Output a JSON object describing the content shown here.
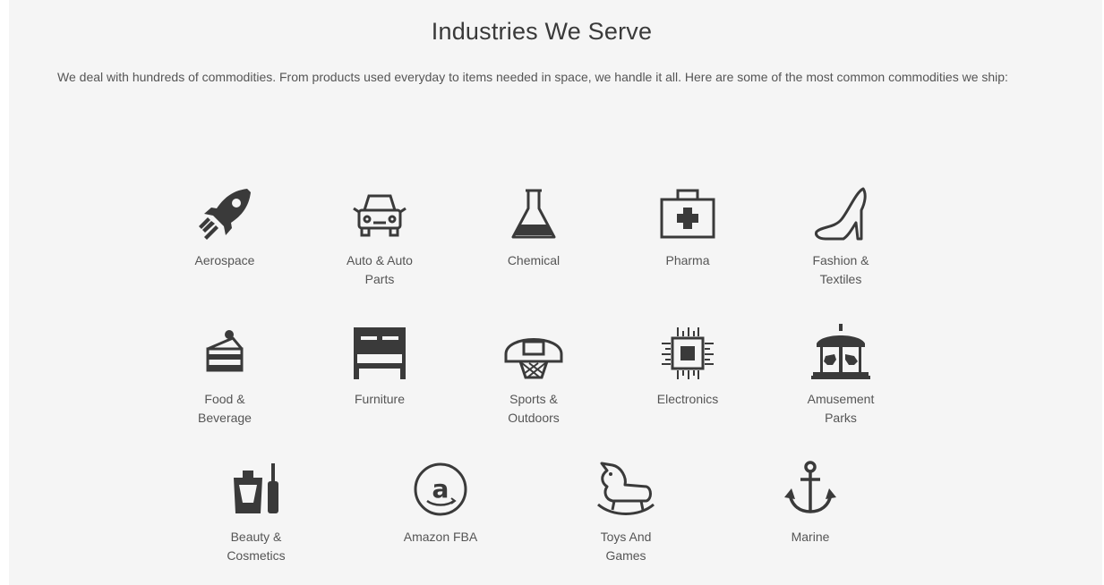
{
  "section": {
    "title": "Industries We Serve",
    "intro": "We deal with hundreds of commodities. From products used everyday to items needed in space, we handle it all. Here are some of the most common commodities we ship:"
  },
  "colors": {
    "icon": "#3a3a3a",
    "text": "#555555",
    "background": "#f5f5f5"
  },
  "industries": [
    {
      "label": "Aerospace",
      "icon": "rocket-icon"
    },
    {
      "label": "Auto & Auto Parts",
      "icon": "car-icon"
    },
    {
      "label": "Chemical",
      "icon": "flask-icon"
    },
    {
      "label": "Pharma",
      "icon": "first-aid-kit-icon"
    },
    {
      "label": "Fashion & Textiles",
      "icon": "high-heel-icon"
    },
    {
      "label": "Food & Beverage",
      "icon": "cake-slice-icon"
    },
    {
      "label": "Furniture",
      "icon": "bed-icon"
    },
    {
      "label": "Sports & Outdoors",
      "icon": "basketball-hoop-icon"
    },
    {
      "label": "Electronics",
      "icon": "microchip-icon"
    },
    {
      "label": "Amusement Parks",
      "icon": "carousel-icon"
    },
    {
      "label": "Beauty & Cosmetics",
      "icon": "perfume-icon"
    },
    {
      "label": "Amazon FBA",
      "icon": "amazon-icon"
    },
    {
      "label": "Toys And Games",
      "icon": "rocking-horse-icon"
    },
    {
      "label": "Marine",
      "icon": "anchor-icon"
    }
  ]
}
